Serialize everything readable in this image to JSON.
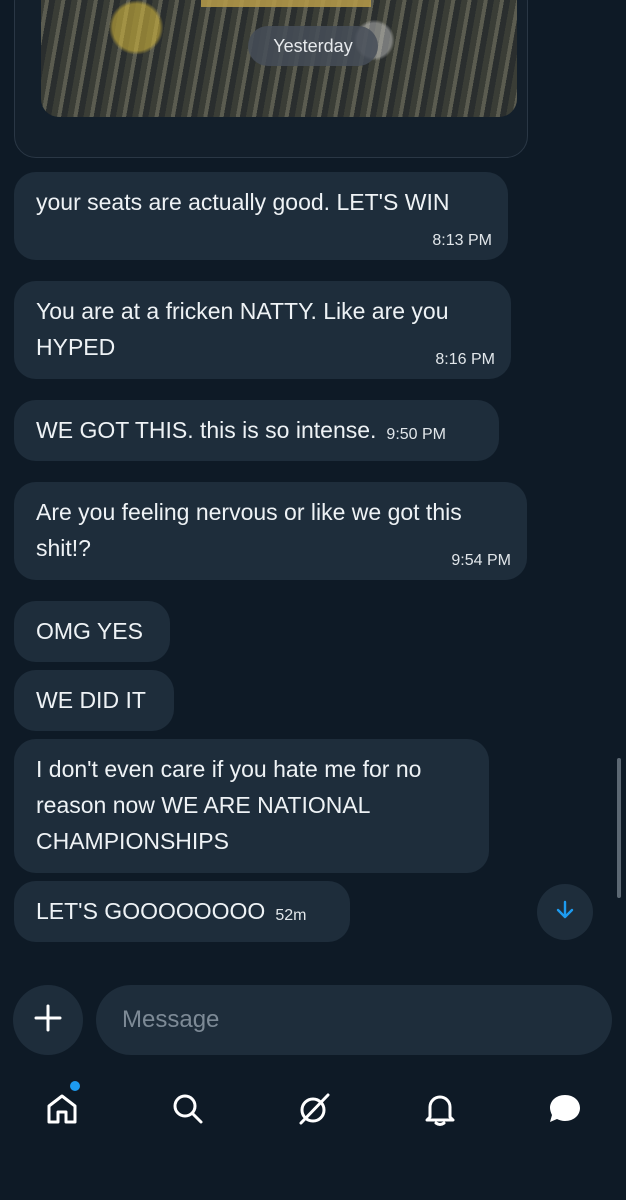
{
  "media": {
    "date_label": "Yesterday"
  },
  "messages": [
    {
      "text": "your seats are actually good. LET'S WIN",
      "time": "8:13 PM"
    },
    {
      "text": "You are at a fricken NATTY. Like are you HYPED",
      "time": "8:16 PM"
    },
    {
      "text": "WE GOT THIS. this is so intense.",
      "time": "9:50 PM"
    },
    {
      "text": "Are you feeling nervous or like we got this shit!?",
      "time": "9:54 PM"
    },
    {
      "text": "OMG YES",
      "time": ""
    },
    {
      "text": "WE DID IT",
      "time": ""
    },
    {
      "text": "I don't even care if you hate me for no reason now WE ARE NATIONAL CHAMPIONSHIPS",
      "time": ""
    },
    {
      "text": "LET'S GOOOOOOOO",
      "time": "52m"
    }
  ],
  "composer": {
    "placeholder": "Message"
  },
  "nav": {
    "items": [
      {
        "icon": "home-icon",
        "has_notification_dot": true
      },
      {
        "icon": "search-icon"
      },
      {
        "icon": "grok-icon"
      },
      {
        "icon": "bell-icon"
      },
      {
        "icon": "messages-icon"
      }
    ]
  },
  "colors": {
    "background": "#0e1a26",
    "bubble": "#1e2d3b",
    "accent": "#1d9bf0"
  }
}
